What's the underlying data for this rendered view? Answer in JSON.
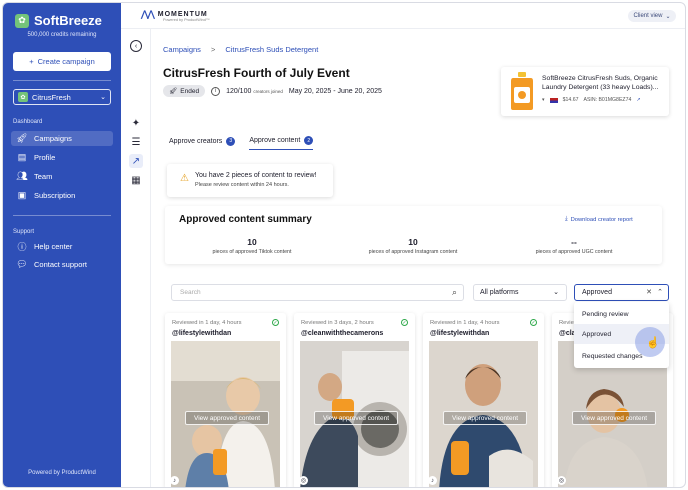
{
  "sidebar": {
    "brand": "SoftBreeze",
    "credits": "500,000 credits remaining",
    "create_label": "Create campaign",
    "selected_brand": "CitrusFresh",
    "dashboard_label": "Dashboard",
    "items": [
      {
        "label": "Campaigns"
      },
      {
        "label": "Profile"
      },
      {
        "label": "Team"
      },
      {
        "label": "Subscription"
      }
    ],
    "support_label": "Support",
    "support_items": [
      {
        "label": "Help center"
      },
      {
        "label": "Contact support"
      }
    ],
    "powered": "Powered by ProductWind"
  },
  "topbar": {
    "logo_text": "MOMENTUM",
    "logo_sub": "Powered by ProductWind™",
    "client_view": "Client view"
  },
  "breadcrumb": {
    "root": "Campaigns",
    "sep": ">",
    "current": "CitrusFresh Suds Detergent"
  },
  "campaign": {
    "title": "CitrusFresh Fourth of July Event",
    "status": "Ended",
    "joined_count": "120/100",
    "joined_label": "creators joined",
    "dates": "May 20, 2025 - June 20, 2025"
  },
  "product": {
    "name": "SoftBreeze CitrusFresh Suds, Organic Laundry Detergent (33 heavy Loads)...",
    "price": "$14.67",
    "asin": "ASIN: B01MG8EZ74"
  },
  "tabs": [
    {
      "label": "Approve creators",
      "count": "3"
    },
    {
      "label": "Approve content",
      "count": "2"
    }
  ],
  "alert": {
    "title": "You have 2 pieces of content to review!",
    "subtitle": "Please review content within 24 hours."
  },
  "summary": {
    "title": "Approved content summary",
    "download": "Download creator report",
    "stats": [
      {
        "value": "10",
        "label": "pieces of approved Tiktok content"
      },
      {
        "value": "10",
        "label": "pieces of approved Instagram content"
      },
      {
        "value": "--",
        "label": "pieces of approved UGC content"
      }
    ]
  },
  "filters": {
    "search_placeholder": "Search",
    "platform": "All platforms",
    "status": "Approved",
    "status_options": [
      "Pending review",
      "Approved",
      "Requested changes"
    ]
  },
  "cards": [
    {
      "reviewed": "Reviewed in 1 day, 4 hours",
      "handle": "@lifestylewithdan",
      "button": "View approved content",
      "platform_icon": "tiktok-icon",
      "glyph": "♪"
    },
    {
      "reviewed": "Reviewed in 3 days, 2 hours",
      "handle": "@cleanwiththecamerons",
      "button": "View approved content",
      "platform_icon": "instagram-icon",
      "glyph": "◎"
    },
    {
      "reviewed": "Reviewed in 1 day, 4 hours",
      "handle": "@lifestylewithdan",
      "button": "View approved content",
      "platform_icon": "tiktok-icon",
      "glyph": "♪"
    },
    {
      "reviewed": "Revie",
      "handle": "@clai",
      "button": "View approved content",
      "platform_icon": "instagram-icon",
      "glyph": "◎"
    }
  ],
  "colors": {
    "brand_blue": "#2e4fb7",
    "success_green": "#2ea84a",
    "warning": "#e5a020"
  }
}
